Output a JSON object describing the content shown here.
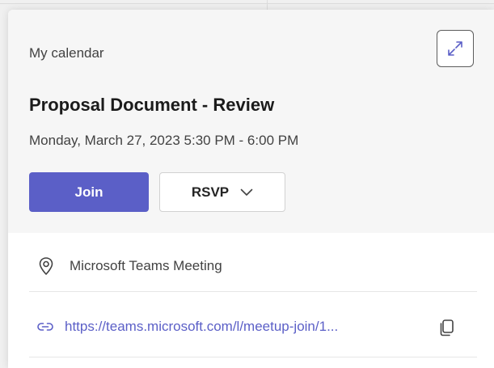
{
  "header": {
    "calendar_label": "My calendar",
    "expand_icon": "expand-icon"
  },
  "event": {
    "title": "Proposal Document - Review",
    "datetime": "Monday, March 27, 2023 5:30 PM - 6:00 PM"
  },
  "actions": {
    "join_label": "Join",
    "rsvp_label": "RSVP"
  },
  "details": {
    "location": "Microsoft Teams Meeting",
    "link": "https://teams.microsoft.com/l/meetup-join/1..."
  },
  "colors": {
    "accent": "#5b5fc7",
    "text_primary": "#242424",
    "text_secondary": "#424242"
  }
}
